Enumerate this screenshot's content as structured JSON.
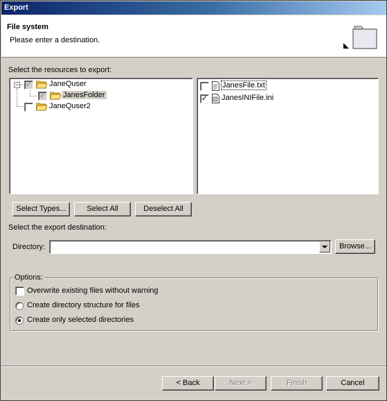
{
  "window": {
    "title": "Export"
  },
  "banner": {
    "title": "File system",
    "subtitle": "Please enter a destination.",
    "icon": "folder-wizard-icon"
  },
  "resources": {
    "label": "Select the resources to export:",
    "tree": [
      {
        "label": "JaneQuser",
        "state": "grayed-checked",
        "expanded": true,
        "icon": "open-folder-icon"
      },
      {
        "label": "JanesFolder",
        "state": "grayed-checked",
        "selected": true,
        "icon": "open-folder-icon"
      },
      {
        "label": "JaneQuser2",
        "state": "unchecked",
        "icon": "open-folder-icon"
      }
    ],
    "files": [
      {
        "label": "JanesFile.txt",
        "checked": false,
        "icon": "text-file-icon"
      },
      {
        "label": "JanesINIFile.ini",
        "checked": true,
        "icon": "ini-file-icon"
      }
    ]
  },
  "buttons": {
    "select_types": "Select Types...",
    "select_all": "Select All",
    "deselect_all": "Deselect All",
    "browse": "Browse...",
    "back": "< Back",
    "next": "Next >",
    "finish": "Finish",
    "cancel": "Cancel"
  },
  "destination": {
    "label": "Select the export destination:",
    "directory_label": "Directory:",
    "directory_value": ""
  },
  "options": {
    "legend": "Options:",
    "overwrite": {
      "label": "Overwrite existing files without warning",
      "checked": false
    },
    "create_structure": {
      "label": "Create directory structure for files",
      "selected": false
    },
    "create_selected": {
      "label": "Create only selected directories",
      "selected": true
    }
  },
  "colors": {
    "titlebar_start": "#0a246a",
    "titlebar_end": "#a6caf0",
    "face": "#d4d0c8"
  }
}
